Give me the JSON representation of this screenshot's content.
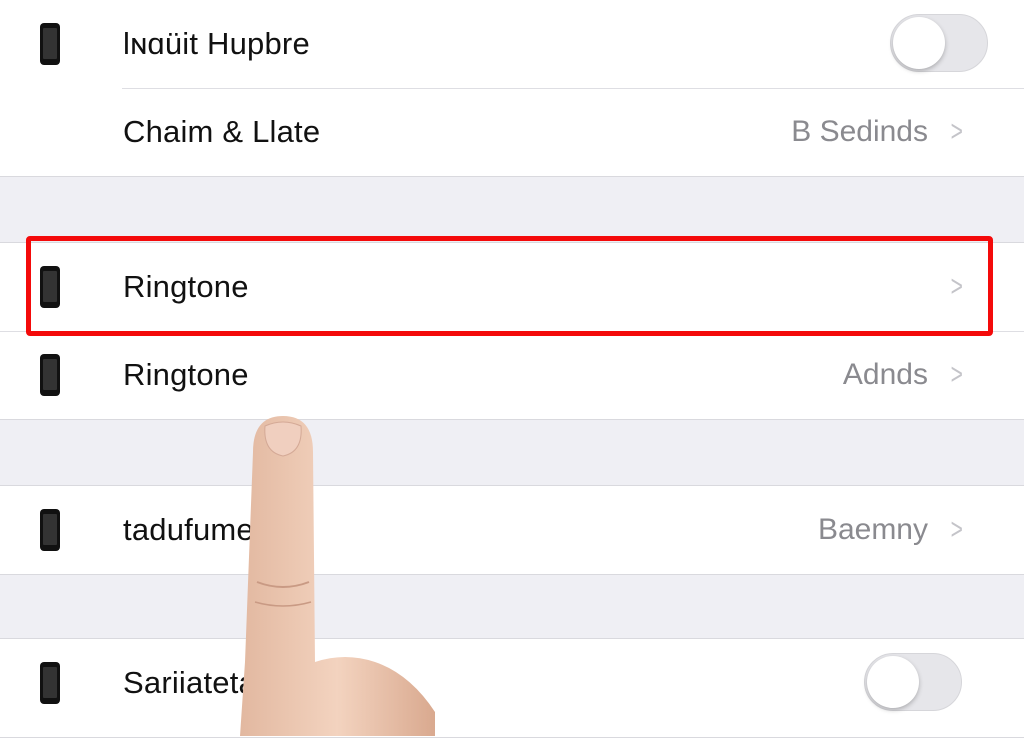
{
  "section1": {
    "rows": [
      {
        "label": "lɴɑüit Hupbre",
        "icon": "phone-icon",
        "control": "toggle",
        "toggle_on": false
      },
      {
        "label": "Chaim & Llate",
        "value": "B Sedinds"
      }
    ]
  },
  "section2": {
    "rows": [
      {
        "label": "Ringtone",
        "icon": "phone-icon",
        "highlighted": true
      },
      {
        "label": "Ringtone",
        "value": "Adnds",
        "icon": "phone-icon"
      }
    ]
  },
  "section3": {
    "rows": [
      {
        "label": "tadufume",
        "value": "Baemny",
        "icon": "phone-icon"
      }
    ]
  },
  "section4": {
    "rows": [
      {
        "label": "Sariiatetaps",
        "icon": "phone-icon",
        "control": "toggle",
        "toggle_on": false
      }
    ]
  },
  "colors": {
    "highlight": "#f40a0a",
    "background": "#efeff4",
    "secondary_text": "#8a8a8f"
  },
  "overlay": {
    "icon": "pointing-finger-icon"
  }
}
